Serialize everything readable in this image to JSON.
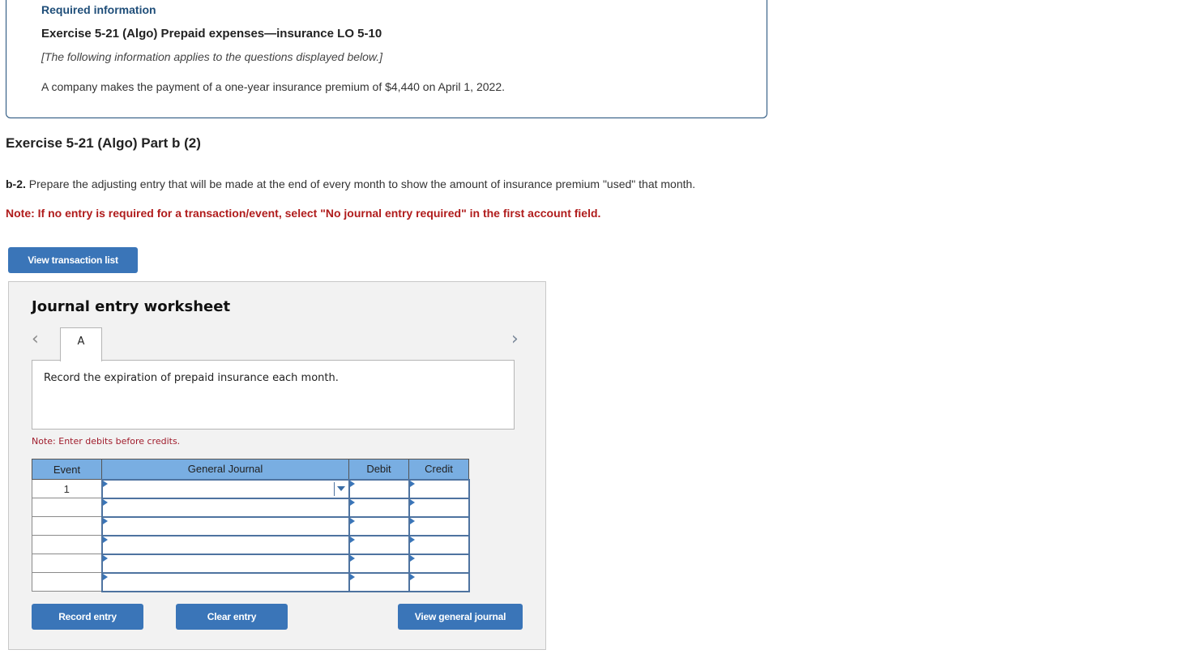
{
  "required_info": {
    "label": "Required information",
    "title": "Exercise 5-21 (Algo) Prepaid expenses—insurance LO 5-10",
    "intro": "[The following information applies to the questions displayed below.]",
    "body": "A company makes the payment of a one-year insurance premium of $4,440 on April 1, 2022."
  },
  "part": {
    "title": "Exercise 5-21 (Algo) Part b (2)",
    "instruction_prefix": "b-2.",
    "instruction_text": " Prepare the adjusting entry that will be made at the end of every month to show the amount of insurance premium \"used\" that month.",
    "note": "Note: If no entry is required for a transaction/event, select \"No journal entry required\" in the first account field."
  },
  "buttons": {
    "view_transaction_list": "View transaction list",
    "record_entry": "Record entry",
    "clear_entry": "Clear entry",
    "view_general_journal": "View general journal"
  },
  "worksheet": {
    "title": "Journal entry worksheet",
    "nav_prev_icon": "‹",
    "nav_next_icon": "›",
    "tabs": [
      {
        "label": "A",
        "selected": true
      }
    ],
    "description": "Record the expiration of prepaid insurance each month.",
    "debit_note": "Note: Enter debits before credits.",
    "table": {
      "headers": {
        "event": "Event",
        "account": "General Journal",
        "debit": "Debit",
        "credit": "Credit"
      },
      "rows": [
        {
          "event": "1",
          "account": "",
          "debit": "",
          "credit": ""
        },
        {
          "event": "",
          "account": "",
          "debit": "",
          "credit": ""
        },
        {
          "event": "",
          "account": "",
          "debit": "",
          "credit": ""
        },
        {
          "event": "",
          "account": "",
          "debit": "",
          "credit": ""
        },
        {
          "event": "",
          "account": "",
          "debit": "",
          "credit": ""
        },
        {
          "event": "",
          "account": "",
          "debit": "",
          "credit": ""
        }
      ]
    }
  }
}
